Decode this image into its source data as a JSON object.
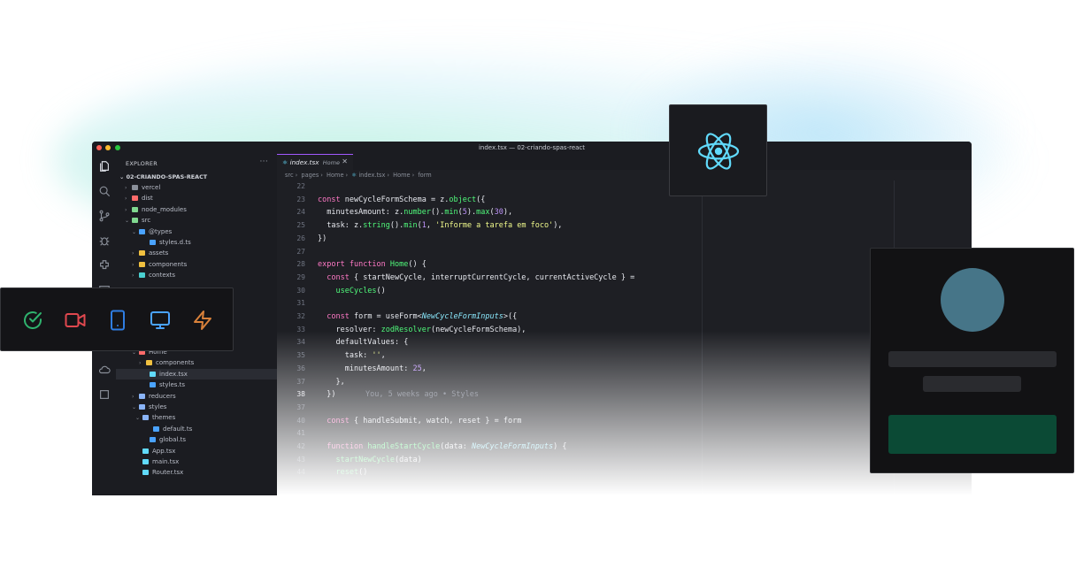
{
  "window": {
    "title": "index.tsx — 02-criando-spas-react"
  },
  "sidebar": {
    "header": "EXPLORER",
    "more": "···",
    "project": "02-CRIANDO-SPAS-REACT",
    "tree": [
      {
        "label": "vercel",
        "chev": "›",
        "color": "#8a8f99"
      },
      {
        "label": "dist",
        "chev": "›",
        "color": "#ff6b6b"
      },
      {
        "label": "node_modules",
        "chev": "›",
        "color": "#7fd88f"
      },
      {
        "label": "src",
        "chev": "⌄",
        "color": "#7fd88f"
      },
      {
        "label": "@types",
        "chev": "⌄",
        "color": "#4aa3ff"
      },
      {
        "label": "styles.d.ts",
        "chev": "",
        "color": "#4aa3ff"
      },
      {
        "label": "assets",
        "chev": "›",
        "color": "#f0c040"
      },
      {
        "label": "components",
        "chev": "›",
        "color": "#f0c040"
      },
      {
        "label": "contexts",
        "chev": "›",
        "color": "#4ad0d0"
      },
      {
        "label": "Home",
        "chev": "⌄",
        "color": "#ff6b6b"
      },
      {
        "label": "components",
        "chev": "›",
        "color": "#f0c040"
      },
      {
        "label": "index.tsx",
        "chev": "",
        "color": "#61dafb"
      },
      {
        "label": "styles.ts",
        "chev": "",
        "color": "#4aa3ff"
      },
      {
        "label": "reducers",
        "chev": "›",
        "color": "#8ab4f8"
      },
      {
        "label": "styles",
        "chev": "⌄",
        "color": "#8ab4f8"
      },
      {
        "label": "themes",
        "chev": "⌄",
        "color": "#8ab4f8"
      },
      {
        "label": "default.ts",
        "chev": "",
        "color": "#4aa3ff"
      },
      {
        "label": "global.ts",
        "chev": "",
        "color": "#4aa3ff"
      },
      {
        "label": "App.tsx",
        "chev": "",
        "color": "#61dafb"
      },
      {
        "label": "main.tsx",
        "chev": "",
        "color": "#61dafb"
      },
      {
        "label": "Router.tsx",
        "chev": "",
        "color": "#61dafb"
      }
    ]
  },
  "tab": {
    "file": "index.tsx",
    "dir": "Home",
    "close": "✕"
  },
  "breadcrumb": [
    "src",
    "pages",
    "Home",
    "index.tsx",
    "Home",
    "form"
  ],
  "code": {
    "line_numbers": [
      "22",
      "23",
      "24",
      "25",
      "26",
      "27",
      "28",
      "29",
      "30",
      "31",
      "32",
      "33",
      "34",
      "35",
      "36",
      "37",
      "38",
      "37",
      "40",
      "41",
      "42",
      "43",
      "44"
    ],
    "current_line": "38",
    "lines": [
      "",
      "const newCycleFormSchema = z.object({",
      "  minutesAmount: z.number().min(5).max(30),",
      "  task: z.string().min(1, 'Informe a tarefa em foco'),",
      "})",
      "",
      "export function Home() {",
      "  const { startNewCycle, interruptCurrentCycle, currentActiveCycle } =",
      "    useCycles()",
      "",
      "  const form = useForm<NewCycleFormInputs>({",
      "    resolver: zodResolver(newCycleFormSchema),",
      "    defaultValues: {",
      "      task: '',",
      "      minutesAmount: 25,",
      "    },",
      "  })",
      "",
      "  const { handleSubmit, watch, reset } = form",
      "",
      "  function handleStartCycle(data: NewCycleFormInputs) {",
      "    startNewCycle(data)",
      "    reset()"
    ],
    "blame": "You, 5 weeks ago • Styles"
  },
  "colors": {
    "accent": "#a259ff",
    "cta": "#0b4a35",
    "avatar": "#467588",
    "react": "#61dafb"
  },
  "devices": [
    "check-circle-icon",
    "video-icon",
    "smartphone-icon",
    "monitor-icon",
    "lightning-icon"
  ]
}
